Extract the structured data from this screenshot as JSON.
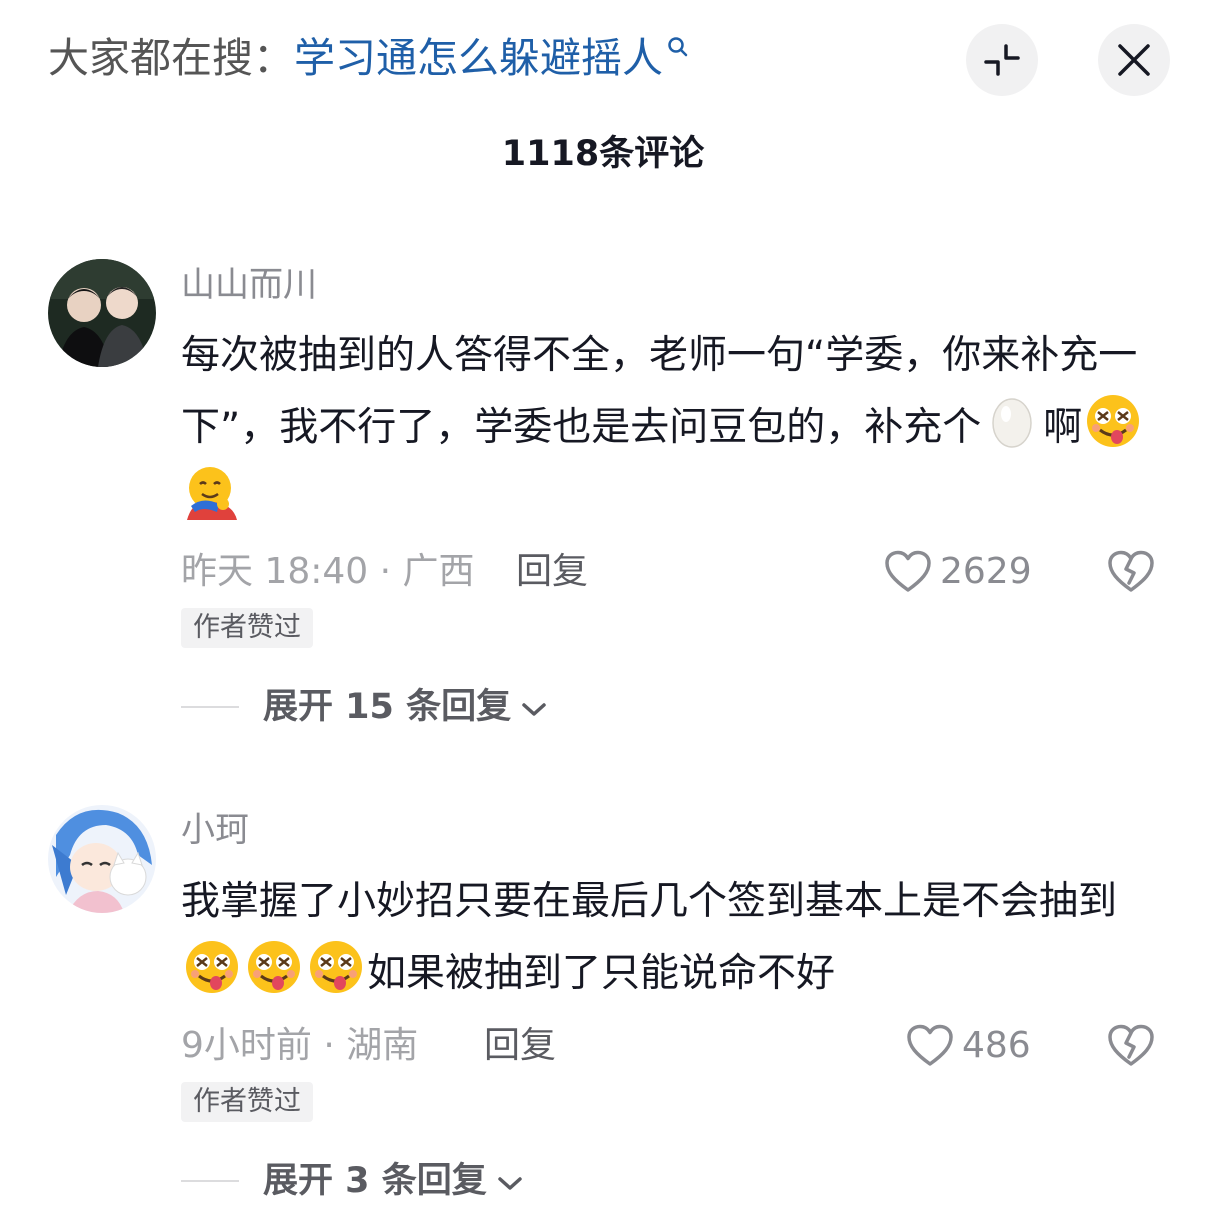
{
  "header": {
    "search_prefix": "大家都在搜：",
    "search_query": "学习通怎么躲避摇人",
    "comment_count_title": "1118条评论"
  },
  "comments": [
    {
      "username": "山山而川",
      "text_1": "每次被抽到的人答得不全，老师一句“学委，你来补充一下”，我不行了，学委也是去问豆包的，补充个",
      "text_2": "啊",
      "time_location": "昨天 18:40 · 广西",
      "reply_label": "回复",
      "likes": "2629",
      "badge": "作者赞过",
      "expand_label": "展开 15 条回复"
    },
    {
      "username": "小珂",
      "text_1": "我掌握了小妙招只要在最后几个签到基本上是不会抽到",
      "text_2": "如果被抽到了只能说命不好",
      "time_location": "9小时前 · 湖南",
      "reply_label": "回复",
      "likes": "486",
      "badge": "作者赞过",
      "expand_label": "展开 3 条回复"
    }
  ],
  "icons": {
    "search": "search-icon",
    "collapse": "collapse-icon",
    "close": "close-icon",
    "like": "heart-outline-icon",
    "dislike": "broken-heart-icon",
    "chevron": "chevron-down-icon",
    "emoji_egg": "egg-emoji",
    "emoji_face": "zany-face-emoji",
    "emoji_hug": "hug-emoji"
  },
  "colors": {
    "link": "#1f5fa8",
    "text": "#161823",
    "secondary": "#8a8b91",
    "muted": "#a3a4a8",
    "badge_bg": "#f2f2f3"
  }
}
